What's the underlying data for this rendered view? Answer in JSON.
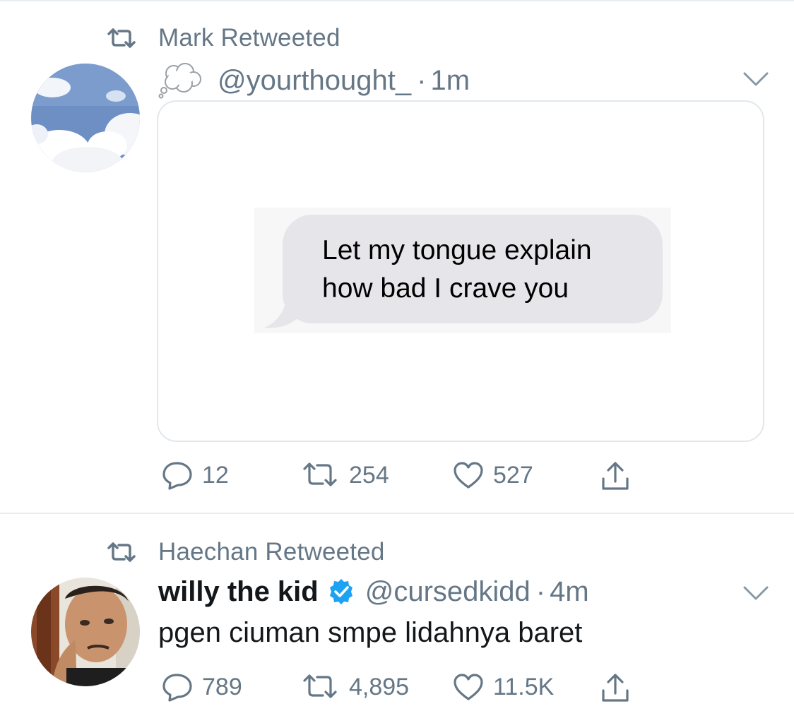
{
  "tweets": [
    {
      "retweeted_by": "Mark Retweeted",
      "avatar_icon": "sky-clouds-avatar",
      "author_emoji": "thought-balloon-icon",
      "handle": "@yourthought_",
      "dot": "·",
      "time": "1m",
      "media_text_line1": "Let my tongue explain",
      "media_text_line2": "how bad I crave you",
      "replies": "12",
      "retweets": "254",
      "likes": "527"
    },
    {
      "retweeted_by": "Haechan Retweeted",
      "avatar_icon": "person-photo-avatar",
      "name": "willy the kid",
      "verified": true,
      "handle": "@cursedkidd",
      "dot": "·",
      "time": "4m",
      "text": "pgen ciuman smpe lidahnya baret",
      "replies": "789",
      "retweets": "4,895",
      "likes": "11.5K"
    }
  ],
  "colors": {
    "secondary_text": "#657786",
    "primary_text": "#14171a",
    "verified_blue": "#1da1f2",
    "border": "#e6ecf0",
    "imessage_gray": "#e5e5ea"
  }
}
